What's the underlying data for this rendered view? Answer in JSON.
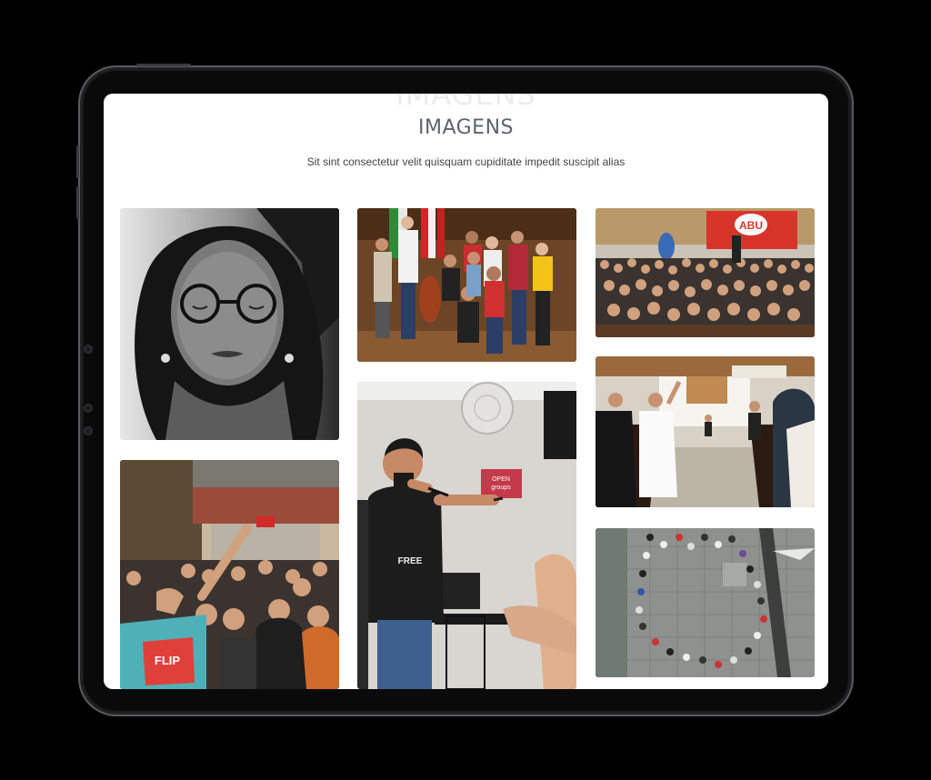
{
  "section": {
    "background_title": "IMAGENS",
    "title": "IMAGENS",
    "subtitle": "Sit sint consectetur velit quisquam cupiditate impedit suscipit alias"
  },
  "gallery": {
    "photos": [
      {
        "name": "woman-eyes-closed-photo"
      },
      {
        "name": "group-with-flags-photo"
      },
      {
        "name": "abu-auditorium-crowd-photo",
        "sign_text": "ABU"
      },
      {
        "name": "crowd-pointing-up-photo",
        "shirt_text": "FLIP"
      },
      {
        "name": "man-microphone-photo",
        "sign_text": "OPEN groups",
        "shirt_text": "FREE"
      },
      {
        "name": "chapel-worship-photo"
      },
      {
        "name": "circle-aerial-photo"
      }
    ]
  }
}
